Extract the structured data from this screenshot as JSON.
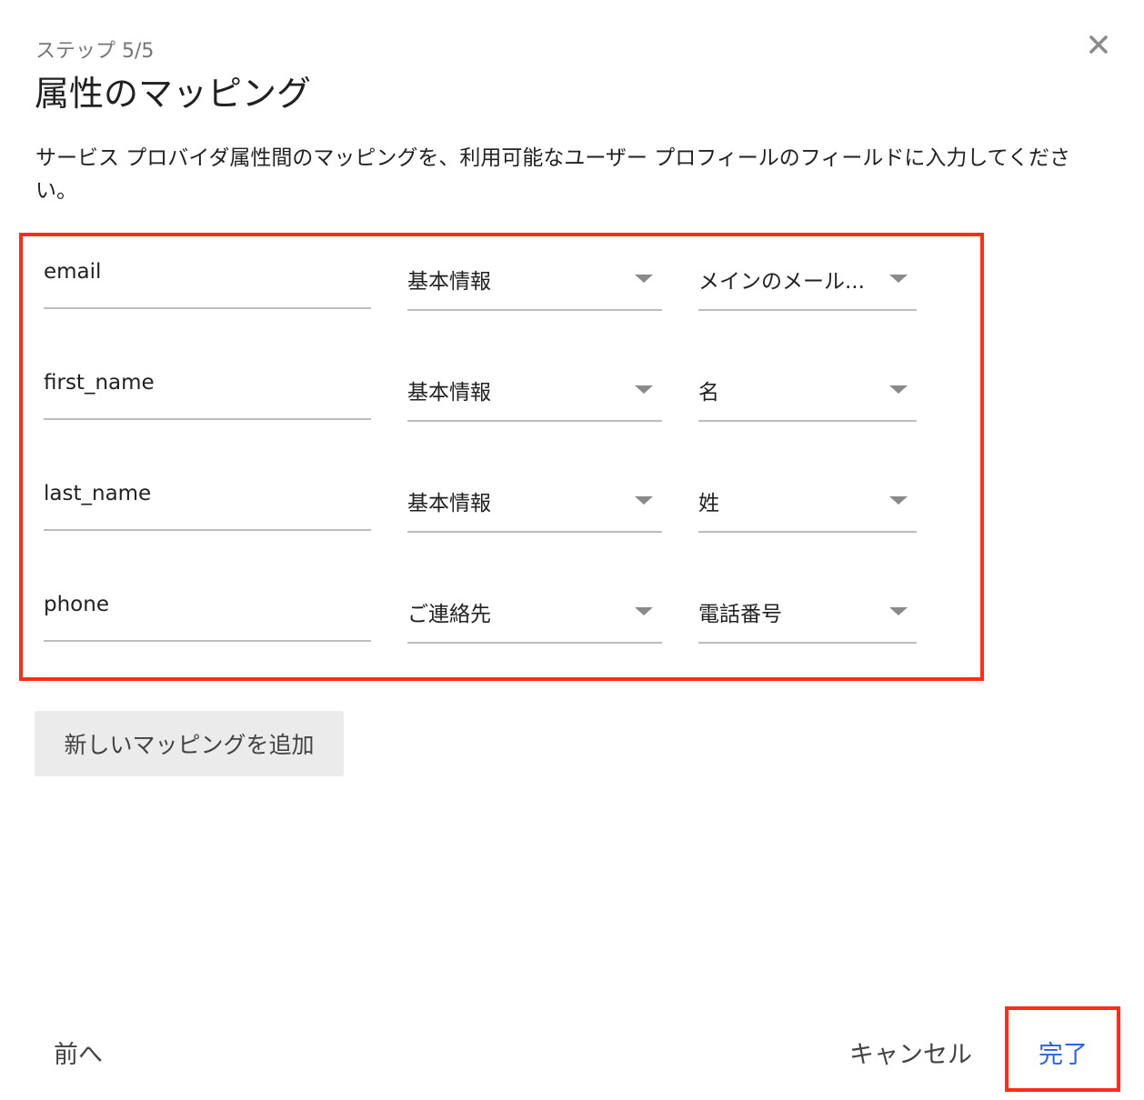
{
  "dialog": {
    "step": "ステップ 5/5",
    "title": "属性のマッピング",
    "description": "サービス プロバイダ属性間のマッピングを、利用可能なユーザー プロフィールのフィールドに入力してください。",
    "close_icon": "close-icon"
  },
  "mappings": [
    {
      "attribute": "email",
      "category": "基本情報",
      "field": "メインのメール..."
    },
    {
      "attribute": "first_name",
      "category": "基本情報",
      "field": "名"
    },
    {
      "attribute": "last_name",
      "category": "基本情報",
      "field": "姓"
    },
    {
      "attribute": "phone",
      "category": "ご連絡先",
      "field": "電話番号"
    }
  ],
  "buttons": {
    "add_mapping": "新しいマッピングを追加",
    "previous": "前へ",
    "cancel": "キャンセル",
    "done": "完了"
  },
  "colors": {
    "highlight": "#ff2d1a",
    "primary": "#2962d9",
    "button_bg": "#ebebeb"
  }
}
